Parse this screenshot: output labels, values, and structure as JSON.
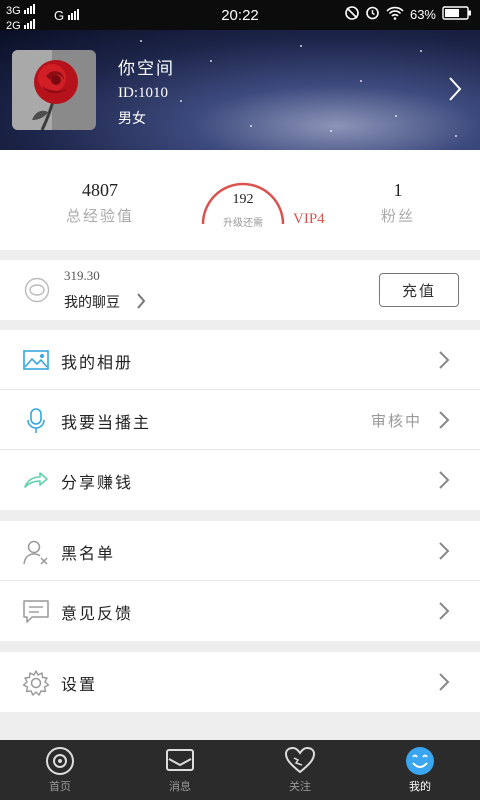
{
  "status_bar": {
    "network_top": "3G",
    "network_bottom": "2G",
    "network_g": "G",
    "time": "20:22",
    "battery": "63%"
  },
  "profile": {
    "name": "你空间",
    "id": "ID:1010",
    "gender": "男女"
  },
  "stats": {
    "experience_value": "4807",
    "experience_label": "总经验值",
    "upgrade_value": "192",
    "upgrade_label": "升级还需",
    "vip_level": "VIP4",
    "fans_value": "1",
    "fans_label": "粉丝"
  },
  "wallet": {
    "amount": "319.30",
    "label": "我的聊豆",
    "recharge_label": "充值"
  },
  "menu": {
    "album": "我的相册",
    "host": "我要当播主",
    "host_status": "审核中",
    "share": "分享赚钱",
    "blacklist": "黑名单",
    "feedback": "意见反馈",
    "settings": "设置"
  },
  "nav": {
    "home": "首页",
    "messages": "消息",
    "follow": "关注",
    "mine": "我的"
  },
  "colors": {
    "accent_red": "#d9534f",
    "icon_blue": "#37a6e0"
  }
}
